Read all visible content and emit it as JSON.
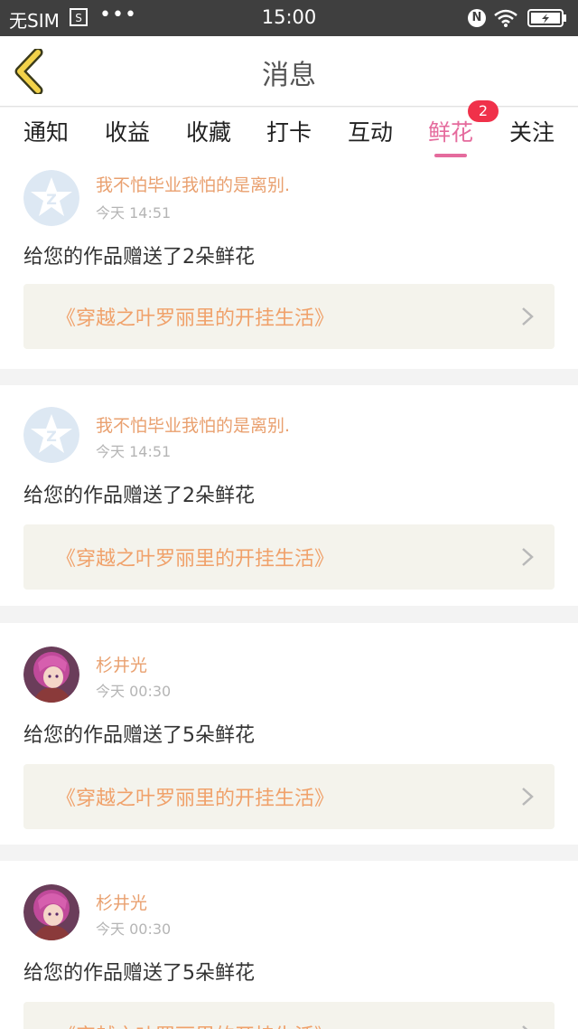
{
  "status_bar": {
    "carrier": "无SIM",
    "dots": "•••",
    "time": "15:00",
    "nfc": "N"
  },
  "nav": {
    "title": "消息"
  },
  "tabs": [
    {
      "label": "通知"
    },
    {
      "label": "收益"
    },
    {
      "label": "收藏"
    },
    {
      "label": "打卡"
    },
    {
      "label": "互动"
    },
    {
      "label": "鲜花",
      "badge": "2"
    },
    {
      "label": "关注"
    }
  ],
  "colors": {
    "accent": "#e56b9d",
    "badge": "#f0314a",
    "username": "#e9a06f",
    "book_title": "#f0a16a"
  },
  "messages": [
    {
      "username": "我不怕毕业我怕的是离别.",
      "time": "今天 14:51",
      "text": "给您的作品赠送了2朵鲜花",
      "book": "《穿越之叶罗丽里的开挂生活》",
      "avatar": "default-avatar"
    },
    {
      "username": "我不怕毕业我怕的是离别.",
      "time": "今天 14:51",
      "text": "给您的作品赠送了2朵鲜花",
      "book": "《穿越之叶罗丽里的开挂生活》",
      "avatar": "default-avatar"
    },
    {
      "username": "杉井光",
      "time": "今天 00:30",
      "text": "给您的作品赠送了5朵鲜花",
      "book": "《穿越之叶罗丽里的开挂生活》",
      "avatar": "anime-avatar"
    },
    {
      "username": "杉井光",
      "time": "今天 00:30",
      "text": "给您的作品赠送了5朵鲜花",
      "book": "《穿越之叶罗丽里的开挂生活》",
      "avatar": "anime-avatar"
    }
  ]
}
